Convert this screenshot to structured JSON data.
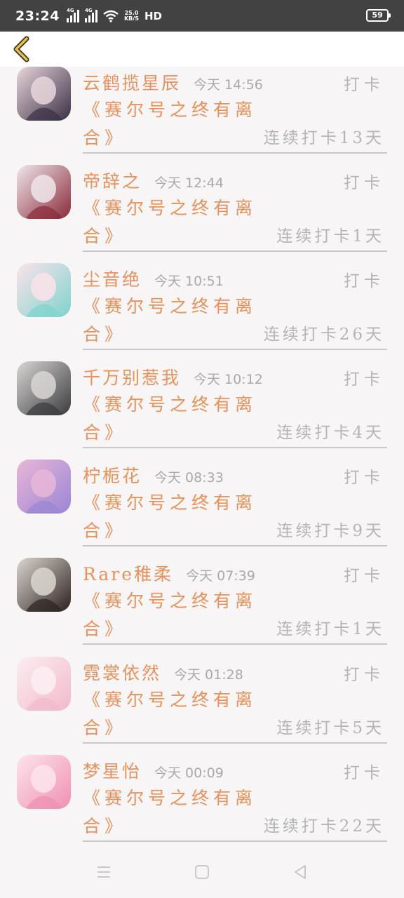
{
  "status_bar": {
    "time": "23:24",
    "signal1_label": "4G",
    "signal2_label": "4G",
    "net_speed_value": "25.0",
    "net_speed_unit": "KB/S",
    "hd_label": "HD",
    "battery": "59"
  },
  "list": [
    {
      "name": "云鹤揽星辰",
      "time": "今天 14:56",
      "action": "打卡",
      "title_line1": "《赛尔号之终有离",
      "title_line2": "合》",
      "streak": "连续打卡13天",
      "avatar_colors": [
        "#3a2f45",
        "#e9d6dc"
      ]
    },
    {
      "name": "帝辞之",
      "time": "今天 12:44",
      "action": "打卡",
      "title_line1": "《赛尔号之终有离",
      "title_line2": "合》",
      "streak": "连续打卡1天",
      "avatar_colors": [
        "#8a2b3a",
        "#efe6ea"
      ]
    },
    {
      "name": "尘音绝",
      "time": "今天 10:51",
      "action": "打卡",
      "title_line1": "《赛尔号之终有离",
      "title_line2": "合》",
      "streak": "连续打卡26天",
      "avatar_colors": [
        "#7fd3cf",
        "#fbe3ea"
      ]
    },
    {
      "name": "千万别惹我",
      "time": "今天 10:12",
      "action": "打卡",
      "title_line1": "《赛尔号之终有离",
      "title_line2": "合》",
      "streak": "连续打卡4天",
      "avatar_colors": [
        "#3b3b3f",
        "#d9d6d4"
      ]
    },
    {
      "name": "柠栀花",
      "time": "今天 08:33",
      "action": "打卡",
      "title_line1": "《赛尔号之终有离",
      "title_line2": "合》",
      "streak": "连续打卡9天",
      "avatar_colors": [
        "#9a86d4",
        "#e9b6d8"
      ]
    },
    {
      "name": "Rare稚柔",
      "time": "今天 07:39",
      "action": "打卡",
      "title_line1": "《赛尔号之终有离",
      "title_line2": "合》",
      "streak": "连续打卡1天",
      "avatar_colors": [
        "#2c2220",
        "#dcd6d0"
      ]
    },
    {
      "name": "霓裳依然",
      "time": "今天 01:28",
      "action": "打卡",
      "title_line1": "《赛尔号之终有离",
      "title_line2": "合》",
      "streak": "连续打卡5天",
      "avatar_colors": [
        "#f2b9c9",
        "#fbeef2"
      ]
    },
    {
      "name": "梦星怡",
      "time": "今天 00:09",
      "action": "打卡",
      "title_line1": "《赛尔号之终有离",
      "title_line2": "合》",
      "streak": "连续打卡22天",
      "avatar_colors": [
        "#f08fb2",
        "#fde4ec"
      ]
    }
  ]
}
